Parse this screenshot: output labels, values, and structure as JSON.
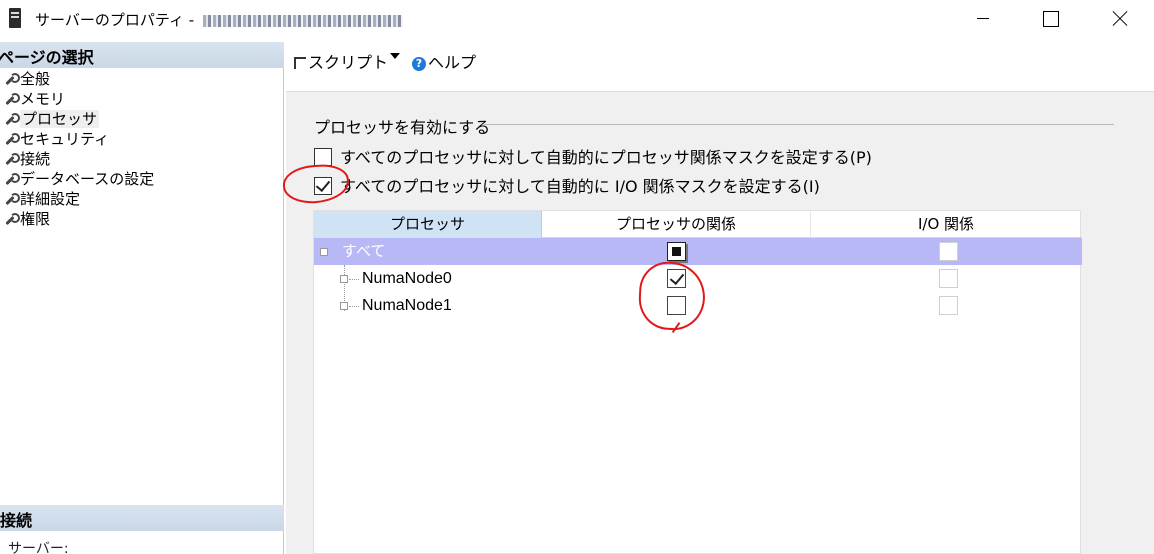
{
  "window": {
    "title": "サーバーのプロパティ - ",
    "icon": "server-icon"
  },
  "left": {
    "select_page_header": "ページの選択",
    "pages": [
      {
        "label": "全般"
      },
      {
        "label": "メモリ"
      },
      {
        "label": "プロセッサ",
        "selected": true
      },
      {
        "label": "セキュリティ"
      },
      {
        "label": "接続"
      },
      {
        "label": "データベースの設定"
      },
      {
        "label": "詳細設定"
      },
      {
        "label": "権限"
      }
    ],
    "connection_header": "接続",
    "server_label": "サーバー:"
  },
  "toolbar": {
    "script_label": "スクリプト",
    "help_label": "ヘルプ"
  },
  "processor": {
    "group_title": "プロセッサを有効にする",
    "auto_affinity_label": "すべてのプロセッサに対して自動的にプロセッサ関係マスクを設定する(P)",
    "auto_affinity_checked": false,
    "auto_io_label": "すべてのプロセッサに対して自動的に I/O 関係マスクを設定する(I)",
    "auto_io_checked": true
  },
  "grid": {
    "columns": [
      "プロセッサ",
      "プロセッサの関係",
      "I/O 関係"
    ],
    "rows": [
      {
        "name": "すべて",
        "affinity": "indeterminate",
        "io": false
      },
      {
        "name": "NumaNode0",
        "affinity": "checked",
        "io": false
      },
      {
        "name": "NumaNode1",
        "affinity": "unchecked",
        "io": false
      }
    ]
  },
  "colors": {
    "header_selected": "#cfe3f5",
    "row_highlight": "#b7b8f5",
    "annotation": "#e21818"
  }
}
